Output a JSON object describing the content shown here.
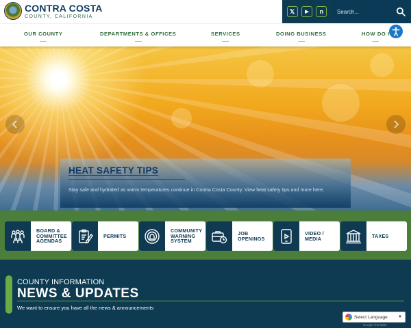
{
  "header": {
    "logo_title": "CONTRA COSTA",
    "logo_subtitle": "COUNTY, CALIFORNIA",
    "social": [
      {
        "name": "x-twitter",
        "glyph": "𝕏"
      },
      {
        "name": "youtube",
        "glyph": "▶"
      },
      {
        "name": "nextdoor",
        "glyph": "n"
      }
    ],
    "search": {
      "placeholder": "Search..."
    }
  },
  "nav": {
    "items": [
      "OUR COUNTY",
      "DEPARTMENTS & OFFICES",
      "SERVICES",
      "DOING BUSINESS",
      "HOW DO I"
    ]
  },
  "hero": {
    "title": "HEAT SAFETY TIPS",
    "text": "Stay safe and hydrated as warm temperatures continue in Contra Costa County. View heat safety tips and more here."
  },
  "quick_links": [
    {
      "label": "BOARD & COMMITTEE AGENDAS",
      "icon": "people-icon"
    },
    {
      "label": "PERMITS",
      "icon": "clipboard-pencil-icon"
    },
    {
      "label": "COMMUNITY WARNING SYSTEM",
      "icon": "alert-siren-icon"
    },
    {
      "label": "JOB OPENINGS",
      "icon": "briefcase-clock-icon"
    },
    {
      "label": "VIDEO / MEDIA",
      "icon": "tablet-play-icon"
    },
    {
      "label": "TAXES",
      "icon": "bank-icon"
    }
  ],
  "news": {
    "kicker": "COUNTY INFORMATION",
    "title": "NEWS & UPDATES",
    "subtitle": "We want to ensure you have all the news & announcements"
  },
  "translate": {
    "label": "Select Language",
    "powered": "Google Translate"
  },
  "colors": {
    "navy": "#0e3a52",
    "green": "#4b7d3b",
    "accent_green": "#6cab43",
    "nav_text": "#2d6b3a"
  }
}
